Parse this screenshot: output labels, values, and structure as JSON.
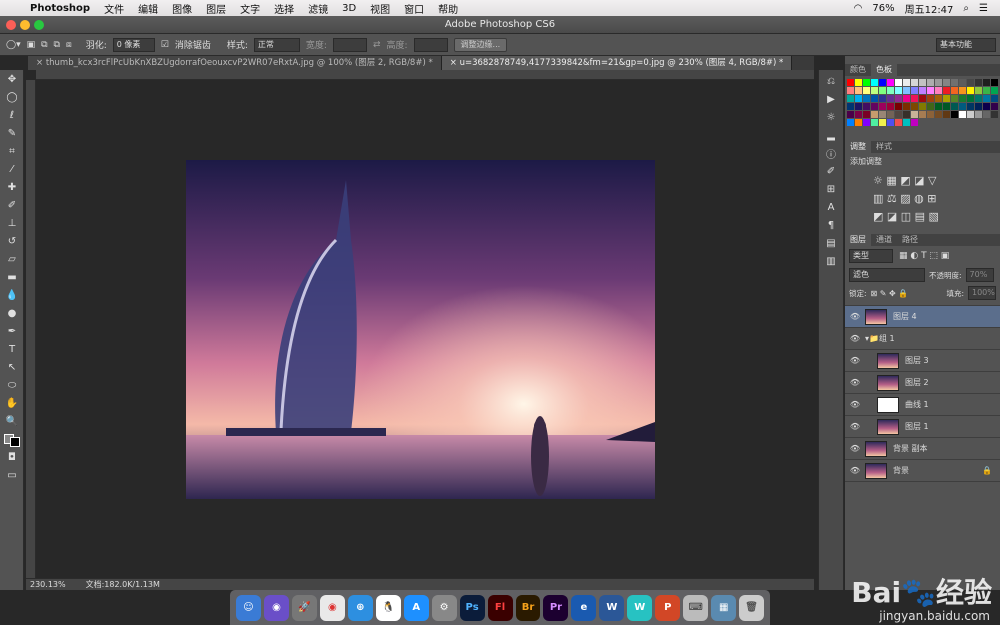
{
  "menubar": {
    "app": "Photoshop",
    "items": [
      "文件",
      "编辑",
      "图像",
      "图层",
      "文字",
      "选择",
      "滤镜",
      "3D",
      "视图",
      "窗口",
      "帮助"
    ],
    "battery": "76%",
    "clock": "周五12:47"
  },
  "window": {
    "title": "Adobe Photoshop CS6"
  },
  "options": {
    "feather_label": "羽化:",
    "feather_value": "0 像素",
    "antialias": "消除锯齿",
    "style_label": "样式:",
    "style_value": "正常",
    "width_label": "宽度:",
    "height_label": "高度:",
    "refine_button": "调整边缘...",
    "workspace": "基本功能"
  },
  "tabs": [
    {
      "label": "thumb_kcx3rcFlPcUbKnXBZUgdorrafOeouxcvP2WR07eRxtA.jpg @ 100% (图层 2, RGB/8#) *"
    },
    {
      "label": "u=3682878749,4177339842&fm=21&gp=0.jpg @ 230% (图层 4, RGB/8#) *"
    }
  ],
  "status": {
    "zoom": "230.13%",
    "doc": "文档:182.0K/1.13M"
  },
  "panels": {
    "color_tab": "颜色",
    "swatch_tab": "色板",
    "adjust_tab": "调整",
    "style_tab": "样式",
    "adjust_title": "添加调整",
    "layers_tab": "图层",
    "channels_tab": "通道",
    "paths_tab": "路径",
    "kind": "类型",
    "blend": "滤色",
    "opacity_label": "不透明度:",
    "opacity": "70%",
    "lock_label": "锁定:",
    "fill_label": "填充:",
    "fill": "100%"
  },
  "layers": [
    {
      "name": "图层 4",
      "selected": true
    },
    {
      "name": "组 1"
    },
    {
      "name": "图层 3"
    },
    {
      "name": "图层 2"
    },
    {
      "name": "曲线 1"
    },
    {
      "name": "图层 1"
    },
    {
      "name": "背景 副本"
    },
    {
      "name": "背景"
    }
  ],
  "swatch_colors": [
    "#ff0000",
    "#ffff00",
    "#00ff00",
    "#00ffff",
    "#0000ff",
    "#ff00ff",
    "#ffffff",
    "#ebebeb",
    "#d6d6d6",
    "#c2c2c2",
    "#adadad",
    "#999999",
    "#858585",
    "#707070",
    "#5c5c5c",
    "#474747",
    "#333333",
    "#1f1f1f",
    "#000000",
    "#ff7f7f",
    "#ffbf7f",
    "#ffff7f",
    "#bfff7f",
    "#7fff7f",
    "#7fffbf",
    "#7fffff",
    "#7fbfff",
    "#7f7fff",
    "#bf7fff",
    "#ff7fff",
    "#ff7fbf",
    "#ed1c24",
    "#f26522",
    "#f7941d",
    "#fff200",
    "#8dc63f",
    "#39b54a",
    "#00a651",
    "#00a99d",
    "#00aeef",
    "#0072bc",
    "#0054a6",
    "#2e3192",
    "#662d91",
    "#92278f",
    "#ec008c",
    "#ed145b",
    "#9e0b0f",
    "#a0410d",
    "#a36209",
    "#aba000",
    "#598527",
    "#197b30",
    "#007236",
    "#00746b",
    "#0076a3",
    "#004b80",
    "#003471",
    "#1b1464",
    "#440e62",
    "#630460",
    "#9e005d",
    "#9e0039",
    "#790000",
    "#7b2e00",
    "#7d4900",
    "#827b00",
    "#406618",
    "#005e20",
    "#005826",
    "#005952",
    "#005b7f",
    "#003663",
    "#002157",
    "#0d004c",
    "#32004b",
    "#4b0049",
    "#7b0046",
    "#7a0026",
    "#c69c6d",
    "#998675",
    "#736357",
    "#534741",
    "#37302a",
    "#c7b299",
    "#a67c52",
    "#8c6239",
    "#754c24",
    "#603813",
    "#000000",
    "#ffffff",
    "#cccccc",
    "#999999",
    "#666666",
    "#333333",
    "#0080ff",
    "#ff8000",
    "#8000ff",
    "#4ff0a0",
    "#f0f04f",
    "#4f4ff0",
    "#f04f4f",
    "#00c0c0",
    "#c000c0"
  ],
  "baidu": {
    "logo": "Bai🐾经验",
    "url": "jingyan.baidu.com"
  }
}
